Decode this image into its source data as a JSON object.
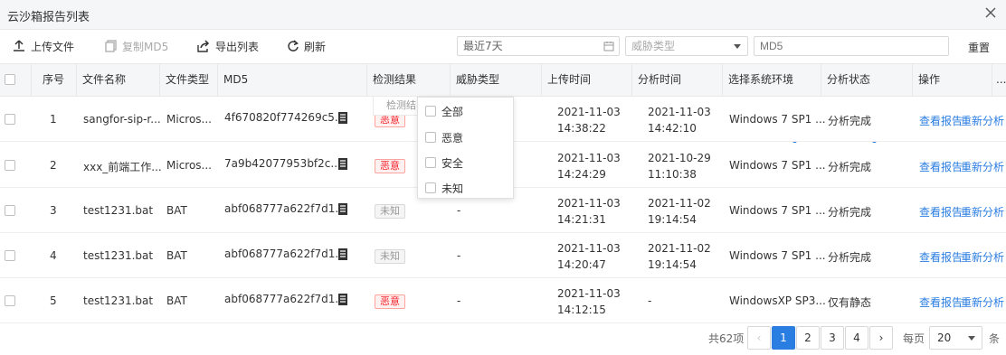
{
  "window": {
    "title": "云沙箱报告列表"
  },
  "toolbar": {
    "upload": "上传文件",
    "copy_md5": "复制MD5",
    "export": "导出列表",
    "refresh": "刷新",
    "date_range": "最近7天",
    "threat_placeholder": "威胁类型",
    "md5_placeholder": "MD5",
    "reset": "重置"
  },
  "table": {
    "headers": {
      "index": "序号",
      "filename": "文件名称",
      "filetype": "文件类型",
      "md5": "MD5",
      "result": "检测结果",
      "threat": "威胁类型",
      "upload_time": "上传时间",
      "analysis_time": "分析时间",
      "env": "选择系统环境",
      "status": "分析状态",
      "actions": "操作",
      "more": "..."
    },
    "rows": [
      {
        "index": "1",
        "filename": "sangfor-sip-r...",
        "filetype": "Micros...",
        "md5": "4f670820f774269c5...",
        "result": "恶意",
        "threat": "",
        "upload_date": "2021-11-03",
        "upload_clock": "14:38:22",
        "analysis_date": "2021-11-03",
        "analysis_clock": "14:42:10",
        "env": "Windows 7 SP1 ...",
        "status": "分析完成",
        "view": "查看报告",
        "reanalyze": "重新分析"
      },
      {
        "index": "2",
        "filename": "xxx_前端工作...",
        "filetype": "Micros...",
        "md5": "7a9b42077953bf2c...",
        "result": "恶意",
        "threat": "",
        "upload_date": "2021-11-03",
        "upload_clock": "14:24:29",
        "analysis_date": "2021-10-29",
        "analysis_clock": "11:10:38",
        "env": "Windows 7 SP1 ...",
        "status": "分析完成",
        "view": "查看报告",
        "reanalyze": "重新分析"
      },
      {
        "index": "3",
        "filename": "test1231.bat",
        "filetype": "BAT",
        "md5": "abf068777a622f7d1...",
        "result": "未知",
        "threat": "-",
        "upload_date": "2021-11-03",
        "upload_clock": "14:21:31",
        "analysis_date": "2021-11-02",
        "analysis_clock": "19:14:54",
        "env": "Windows 7 SP1 ...",
        "status": "分析完成",
        "view": "查看报告",
        "reanalyze": "重新分析"
      },
      {
        "index": "4",
        "filename": "test1231.bat",
        "filetype": "BAT",
        "md5": "abf068777a622f7d1...",
        "result": "未知",
        "threat": "-",
        "upload_date": "2021-11-03",
        "upload_clock": "14:20:47",
        "analysis_date": "2021-11-02",
        "analysis_clock": "19:14:54",
        "env": "Windows 7 SP1 ...",
        "status": "分析完成",
        "view": "查看报告",
        "reanalyze": "重新分析"
      },
      {
        "index": "5",
        "filename": "test1231.bat",
        "filetype": "BAT",
        "md5": "abf068777a622f7d1...",
        "result": "恶意",
        "threat": "-",
        "upload_date": "2021-11-03",
        "upload_clock": "14:12:15",
        "analysis_date": "-",
        "analysis_clock": "",
        "env": "WindowsXP SP3...",
        "status": "仅有静态",
        "view": "查看报告",
        "reanalyze": "重新分析"
      }
    ]
  },
  "filter_dropdown": {
    "tooltip": "检测结果",
    "options": [
      "全部",
      "恶意",
      "安全",
      "未知"
    ]
  },
  "pagination": {
    "total": "共62项",
    "pages": [
      "1",
      "2",
      "3",
      "4"
    ],
    "current": "1",
    "per_page_label": "每页",
    "page_size": "20",
    "unit": "条",
    "prev": "‹",
    "next": "›"
  },
  "colors": {
    "accent": "#2a7de1",
    "danger": "#f5222d"
  }
}
